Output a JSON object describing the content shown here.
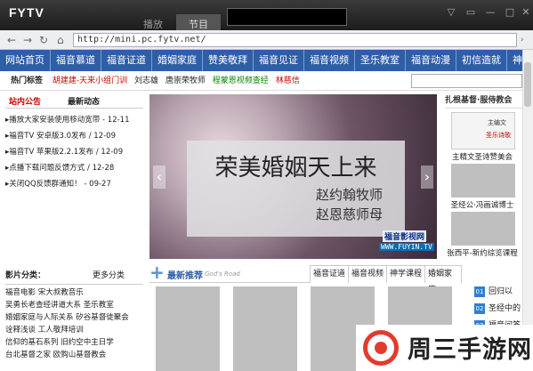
{
  "app": {
    "title": "FYTV",
    "tabs": [
      "播放",
      "节目"
    ]
  },
  "browser": {
    "url": "http://mini.pc.fytv.net/"
  },
  "nav": [
    "网站首页",
    "福音慕道",
    "福音证道",
    "婚姻家庭",
    "赞美敬拜",
    "福音见证",
    "福音视频",
    "圣乐教室",
    "福音动漫",
    "初信造就",
    "神学"
  ],
  "hot": {
    "label": "热门标签",
    "tags": [
      "胡建建-天来小组门训",
      "刘志雄",
      "唐崇荣牧师",
      "程蒙恩视频查经",
      "林慈信"
    ]
  },
  "notice": {
    "tab1": "站内公告",
    "tab2": "最新动态",
    "items": [
      {
        "t": "播放大家安装使用移动宽带",
        "d": "12-11"
      },
      {
        "t": "福音TV 安卓版3.0发布",
        "d": "12-09"
      },
      {
        "t": "福音TV 苹果版2.2.1发布",
        "d": "12-09"
      },
      {
        "t": "点播下载问题反馈方式",
        "d": "12-28"
      },
      {
        "t": "关闭QQ反馈群通知！",
        "d": "09-27"
      }
    ]
  },
  "banner": {
    "title": "荣美婚姻天上来",
    "line1": "赵约翰牧师",
    "line2": "赵恩慈师母",
    "mark1": "福音影视网",
    "mark2": "WWW.FUYIN.TV"
  },
  "right": {
    "title": "扎根基督·服侍教会",
    "caps": [
      "主精文圣诗赞美会",
      "圣经公·冯画诚博士",
      "张西平-新约综览课程"
    ],
    "badge1": "主编文",
    "badge2": "圣乐诗歌"
  },
  "category": {
    "title": "影片分类：",
    "more": "更多分类",
    "lines": [
      "福音电影 宋大叔教音乐",
      "吴勇长老查经讲道大系 圣乐教室",
      "婚姻家庭与人际关系 矽谷基督徒聚会",
      "诠释浅谈 工人敬拜培训",
      "信仰的基石系列 旧约空中主日学",
      "台北基督之家 欧购山基督教会"
    ]
  },
  "recommend": {
    "title": "最新推荐",
    "sub": "God's Road",
    "tabs": [
      "福音证道",
      "福音视频",
      "神学课程",
      "婚姻家庭"
    ]
  },
  "sidelist": [
    {
      "n": "01",
      "t": "回归以"
    },
    {
      "n": "02",
      "t": "圣经中的"
    },
    {
      "n": "03",
      "t": "福音问答"
    }
  ],
  "watermark": "周三手游网"
}
